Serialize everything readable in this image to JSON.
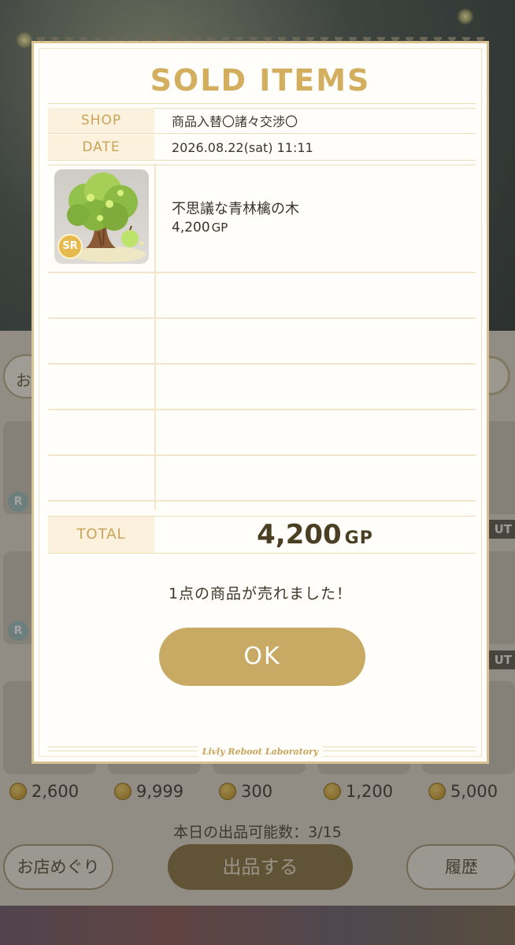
{
  "modal": {
    "title": "SOLD ITEMS",
    "shop_label": "SHOP",
    "shop_value": "商品入替〇諸々交渉〇",
    "date_label": "DATE",
    "date_value": "2026.08.22(sat) 11:11",
    "items": [
      {
        "name": "不思議な青林檎の木",
        "price": "4,200",
        "price_unit": "GP",
        "rarity": "SR"
      }
    ],
    "total_label": "TOTAL",
    "total_value": "4,200",
    "total_unit": "GP",
    "message": "1点の商品が売れました！",
    "ok_label": "OK",
    "footer": "Livly Reboot Laboratory"
  },
  "background": {
    "search_label": "お",
    "rarity_badges": [
      "R",
      "R"
    ],
    "out_labels": [
      "UT",
      "UT"
    ],
    "prices": [
      "2,600",
      "9,999",
      "300",
      "1,200",
      "5,000"
    ],
    "listing_count": "本日の出品可能数：3/15",
    "shop_tour_button": "お店めぐり",
    "list_button": "出品する",
    "history_button": "履歴"
  },
  "colors": {
    "accent_gold": "#d2ae5e",
    "ok_button": "#c9aa64",
    "label_bg": "#fbf1dc"
  }
}
